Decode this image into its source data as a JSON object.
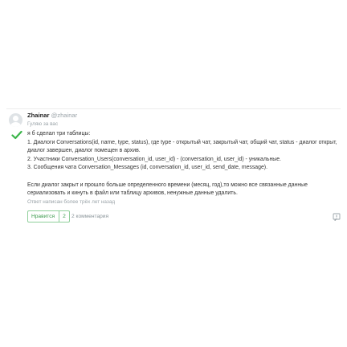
{
  "answer": {
    "author": {
      "name": "Zhainar",
      "nick": "@zhainar",
      "role": "Гуляю за вас"
    },
    "text_lines": [
      "я б сделал три таблицы:",
      "1. Диалоги Conversations(id, name, type, status), где type - открытый чат, закрытый чат, общий чат, status - диалог открыт,",
      "диалог завершен, диалог помещен в архив.",
      "2. Участники Conversation_Users(conversation_id, user_id) - (conversation_id, user_id) - уникальные.",
      "3. Сообщения чата Conversation_Messages (id, conversation_id, user_id, send_date, message)."
    ],
    "text_lines_2": [
      "Если диалог закрыт и прошло больше определенного времени (месяц, год),то можно все связанные данные",
      "сериализовать и кинуть в файл или таблицу архивов, ненужные данные удалить."
    ],
    "timestamp": "Ответ написан более трёх лет назад",
    "like_label": "Нравится",
    "like_count": "2",
    "comments_label": "2 комментария",
    "icons": {
      "avatar": "user-avatar-placeholder",
      "solution": "checkmark-icon",
      "report": "report-flag-icon"
    },
    "colors": {
      "accent_green": "#3a9a4b",
      "muted": "#9aa3a8"
    }
  }
}
